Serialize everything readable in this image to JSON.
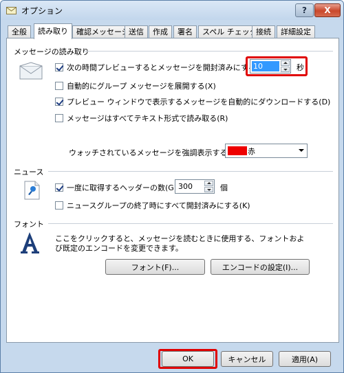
{
  "window": {
    "title": "オプション",
    "help_label": "?",
    "close_label": "X"
  },
  "tabs": [
    {
      "label": "全般"
    },
    {
      "label": "読み取り"
    },
    {
      "label": "確認メッセージ"
    },
    {
      "label": "送信"
    },
    {
      "label": "作成"
    },
    {
      "label": "署名"
    },
    {
      "label": "スペル チェック"
    },
    {
      "label": "接続"
    },
    {
      "label": "詳細設定"
    }
  ],
  "reading": {
    "group_title": "メッセージの読み取り",
    "mark_read_label": "次の時間プレビューするとメッセージを開封済みにする(M)",
    "mark_read_checked": true,
    "seconds_value": "10",
    "seconds_unit": "秒",
    "auto_expand_label": "自動的にグループ メッセージを展開する(X)",
    "auto_expand_checked": false,
    "auto_download_label": "プレビュー ウィンドウで表示するメッセージを自動的にダウンロードする(D)",
    "auto_download_checked": true,
    "plain_text_label": "メッセージはすべてテキスト形式で読み取る(R)",
    "plain_text_checked": false,
    "highlight_label": "ウォッチされているメッセージを強調表示する",
    "highlight_color_name": "赤",
    "highlight_color": "#ee0000"
  },
  "news": {
    "group_title": "ニュース",
    "headers_label": "一度に取得するヘッダーの数(G)",
    "headers_checked": true,
    "headers_value": "300",
    "headers_unit": "個",
    "mark_all_read_label": "ニュースグループの終了時にすべて開封済みにする(K)",
    "mark_all_read_checked": false
  },
  "fonts": {
    "group_title": "フォント",
    "description_line1": "ここをクリックすると、メッセージを読むときに使用する、フォントおよ",
    "description_line2": "び既定のエンコードを変更できます。",
    "font_button": "フォント(F)...",
    "encoding_button": "エンコードの設定(I)..."
  },
  "footer": {
    "ok": "OK",
    "cancel": "キャンセル",
    "apply": "適用(A)"
  },
  "colors": {
    "highlight_frame": "#e00000",
    "accent": "#1e3d82"
  }
}
